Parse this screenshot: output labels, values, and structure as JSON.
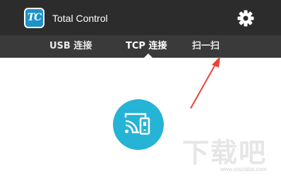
{
  "app": {
    "logo_text": "TC",
    "title": "Total Control",
    "settings_icon": "gear-icon"
  },
  "tabs": [
    {
      "label": "USB 连接",
      "selected": false
    },
    {
      "label": "TCP 连接",
      "selected": true
    },
    {
      "label": "扫一扫",
      "selected": false
    }
  ],
  "main": {
    "cast_icon": "screen-cast-icon",
    "cast_color": "#25b3d6"
  },
  "annotation": {
    "arrow_color": "#e8443a"
  },
  "watermark": {
    "text": "下载吧",
    "sub": "www.xiazaiba.com"
  },
  "colors": {
    "appbar": "#2c2c2c",
    "tabbar": "#3a3a3a",
    "logo": "#1b92c8"
  }
}
